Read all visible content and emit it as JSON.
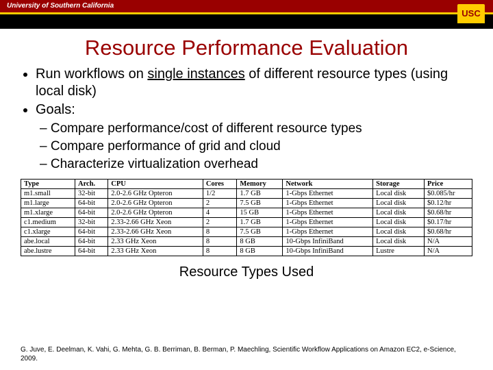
{
  "header": {
    "university": "University of Southern California",
    "logo": "USC"
  },
  "title": "Resource Performance Evaluation",
  "bullet1_a": "Run workflows on ",
  "bullet1_b": "single instances",
  "bullet1_c": " of different resource types (using local disk)",
  "bullet2": "Goals:",
  "sub1": "Compare performance/cost of different resource types",
  "sub2": "Compare performance of grid and cloud",
  "sub3": "Characterize virtualization overhead",
  "headers": {
    "c0": "Type",
    "c1": "Arch.",
    "c2": "CPU",
    "c3": "Cores",
    "c4": "Memory",
    "c5": "Network",
    "c6": "Storage",
    "c7": "Price"
  },
  "rows": [
    {
      "c0": "m1.small",
      "c1": "32-bit",
      "c2": "2.0-2.6 GHz Opteron",
      "c3": "1/2",
      "c4": "1.7 GB",
      "c5": "1-Gbps Ethernet",
      "c6": "Local disk",
      "c7": "$0.085/hr"
    },
    {
      "c0": "m1.large",
      "c1": "64-bit",
      "c2": "2.0-2.6 GHz Opteron",
      "c3": "2",
      "c4": "7.5 GB",
      "c5": "1-Gbps Ethernet",
      "c6": "Local disk",
      "c7": "$0.12/hr"
    },
    {
      "c0": "m1.xlarge",
      "c1": "64-bit",
      "c2": "2.0-2.6 GHz Opteron",
      "c3": "4",
      "c4": "15 GB",
      "c5": "1-Gbps Ethernet",
      "c6": "Local disk",
      "c7": "$0.68/hr"
    },
    {
      "c0": "c1.medium",
      "c1": "32-bit",
      "c2": "2.33-2.66 GHz Xeon",
      "c3": "2",
      "c4": "1.7 GB",
      "c5": "1-Gbps Ethernet",
      "c6": "Local disk",
      "c7": "$0.17/hr"
    },
    {
      "c0": "c1.xlarge",
      "c1": "64-bit",
      "c2": "2.33-2.66 GHz Xeon",
      "c3": "8",
      "c4": "7.5 GB",
      "c5": "1-Gbps Ethernet",
      "c6": "Local disk",
      "c7": "$0.68/hr"
    },
    {
      "c0": "abe.local",
      "c1": "64-bit",
      "c2": "2.33 GHz Xeon",
      "c3": "8",
      "c4": "8 GB",
      "c5": "10-Gbps InfiniBand",
      "c6": "Local disk",
      "c7": "N/A"
    },
    {
      "c0": "abe.lustre",
      "c1": "64-bit",
      "c2": "2.33 GHz Xeon",
      "c3": "8",
      "c4": "8 GB",
      "c5": "10-Gbps InfiniBand",
      "c6": "Lustre",
      "c7": "N/A"
    }
  ],
  "caption": "Resource Types Used",
  "citation": "G. Juve, E. Deelman, K. Vahi, G. Mehta, G. B. Berriman, B. Berman, P. Maechling, Scientific Workflow Applications on Amazon EC2, e-Science, 2009."
}
